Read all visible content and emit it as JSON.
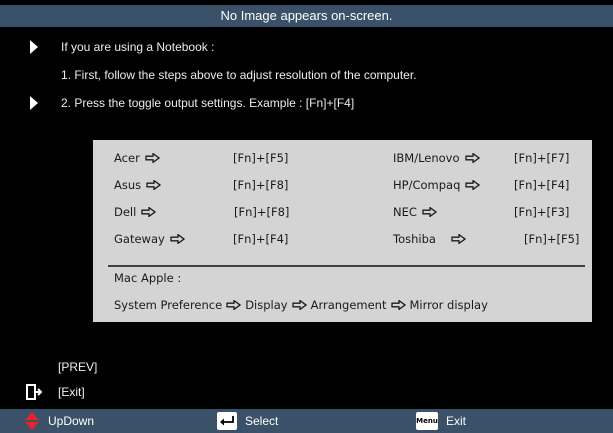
{
  "header": {
    "title": "No Image appears on-screen."
  },
  "instructions": {
    "line1": "If you are using a Notebook :",
    "line2": "1. First, follow the steps above to adjust resolution of the computer.",
    "line3": "2. Press the toggle output settings. Example : [Fn]+[F4]"
  },
  "shortcuts": [
    {
      "brand": "Acer",
      "keys": "[Fn]+[F5]"
    },
    {
      "brand": "Asus",
      "keys": "[Fn]+[F8]"
    },
    {
      "brand": "Dell",
      "keys": "[Fn]+[F8]"
    },
    {
      "brand": "Gateway",
      "keys": "[Fn]+[F4]"
    },
    {
      "brand": "IBM/Lenovo",
      "keys": "[Fn]+[F7]"
    },
    {
      "brand": "HP/Compaq",
      "keys": "[Fn]+[F4]"
    },
    {
      "brand": "NEC",
      "keys": "[Fn]+[F3]"
    },
    {
      "brand": "Toshiba",
      "keys": "[Fn]+[F5]"
    }
  ],
  "mac": {
    "label": "Mac Apple :",
    "path": [
      "System Preference",
      "Display",
      "Arrangement",
      "Mirror display"
    ]
  },
  "nav": {
    "prev": "[PREV]",
    "exit": "[Exit]"
  },
  "footer": {
    "updown": "UpDown",
    "select": "Select",
    "menu_key": "Menu",
    "exit": "Exit"
  },
  "colors": {
    "bar": "#3a5169",
    "panel": "#d4d4d4",
    "accent_red": "#e3252a"
  }
}
